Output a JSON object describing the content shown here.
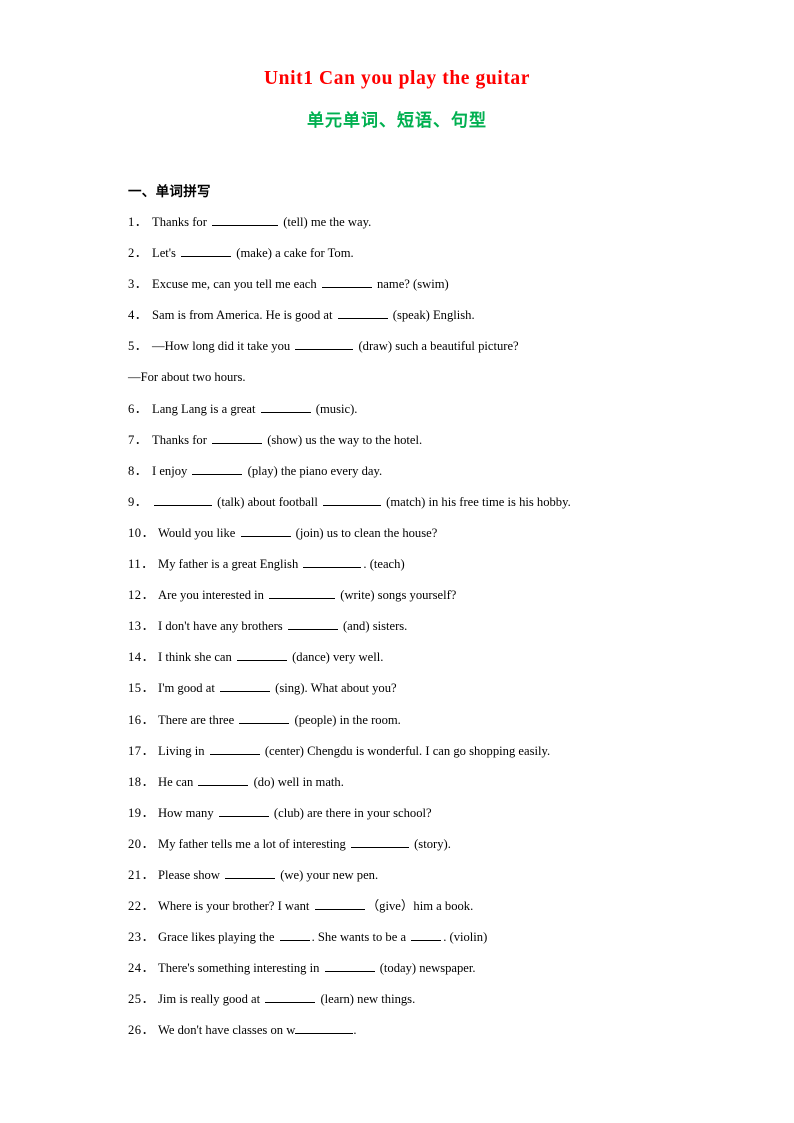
{
  "document": {
    "title": "Unit1 Can you play the guitar",
    "subtitle": "单元单词、短语、句型",
    "title_color": "#FF0000",
    "subtitle_color": "#00B050"
  },
  "section": {
    "heading": "一、单词拼写"
  },
  "questions": [
    {
      "num": "1．",
      "parts": [
        {
          "t": "text",
          "v": "Thanks for "
        },
        {
          "t": "blank",
          "w": "b-xl"
        },
        {
          "t": "text",
          "v": " (tell) me the way."
        }
      ]
    },
    {
      "num": "2．",
      "parts": [
        {
          "t": "text",
          "v": "Let's "
        },
        {
          "t": "blank",
          "w": "b-md"
        },
        {
          "t": "text",
          "v": " (make) a cake for Tom."
        }
      ]
    },
    {
      "num": "3．",
      "parts": [
        {
          "t": "text",
          "v": "Excuse me, can you tell me each "
        },
        {
          "t": "blank",
          "w": "b-md"
        },
        {
          "t": "text",
          "v": " name? (swim)"
        }
      ]
    },
    {
      "num": "4．",
      "parts": [
        {
          "t": "text",
          "v": "Sam is from America. He is good at "
        },
        {
          "t": "blank",
          "w": "b-md"
        },
        {
          "t": "text",
          "v": " (speak) English."
        }
      ]
    },
    {
      "num": "5．",
      "parts": [
        {
          "t": "text",
          "v": "—How long did it take you "
        },
        {
          "t": "blank",
          "w": "b-lg"
        },
        {
          "t": "text",
          "v": " (draw) such a beautiful picture?"
        }
      ]
    },
    {
      "num": "",
      "continuation": true,
      "parts": [
        {
          "t": "text",
          "v": "—For about two hours."
        }
      ]
    },
    {
      "num": "6．",
      "parts": [
        {
          "t": "text",
          "v": "Lang Lang is a great "
        },
        {
          "t": "blank",
          "w": "b-md"
        },
        {
          "t": "text",
          "v": " (music)."
        }
      ]
    },
    {
      "num": "7．",
      "parts": [
        {
          "t": "text",
          "v": "Thanks for "
        },
        {
          "t": "blank",
          "w": "b-md"
        },
        {
          "t": "text",
          "v": " (show) us the way to the hotel."
        }
      ]
    },
    {
      "num": "8．",
      "parts": [
        {
          "t": "text",
          "v": "I enjoy "
        },
        {
          "t": "blank",
          "w": "b-md"
        },
        {
          "t": "text",
          "v": " (play) the piano every day."
        }
      ]
    },
    {
      "num": "9．",
      "parts": [
        {
          "t": "blank",
          "w": "b-lg"
        },
        {
          "t": "text",
          "v": " (talk) about football "
        },
        {
          "t": "blank",
          "w": "b-lg"
        },
        {
          "t": "text",
          "v": " (match) in his free time is his hobby."
        }
      ]
    },
    {
      "num": "10．",
      "wide": true,
      "parts": [
        {
          "t": "text",
          "v": "Would you like "
        },
        {
          "t": "blank",
          "w": "b-md"
        },
        {
          "t": "text",
          "v": " (join) us to clean the house?"
        }
      ]
    },
    {
      "num": "11．",
      "wide": true,
      "parts": [
        {
          "t": "text",
          "v": "My father is a great English "
        },
        {
          "t": "blank",
          "w": "b-lg"
        },
        {
          "t": "text",
          "v": ". (teach)"
        }
      ]
    },
    {
      "num": "12．",
      "wide": true,
      "parts": [
        {
          "t": "text",
          "v": "Are you interested in "
        },
        {
          "t": "blank",
          "w": "b-xl"
        },
        {
          "t": "text",
          "v": " (write) songs yourself?"
        }
      ]
    },
    {
      "num": "13．",
      "wide": true,
      "parts": [
        {
          "t": "text",
          "v": "I don't have any brothers "
        },
        {
          "t": "blank",
          "w": "b-md"
        },
        {
          "t": "text",
          "v": " (and) sisters."
        }
      ]
    },
    {
      "num": "14．",
      "wide": true,
      "parts": [
        {
          "t": "text",
          "v": "I think she can "
        },
        {
          "t": "blank",
          "w": "b-md"
        },
        {
          "t": "text",
          "v": " (dance) very well."
        }
      ]
    },
    {
      "num": "15．",
      "wide": true,
      "parts": [
        {
          "t": "text",
          "v": "I'm good at "
        },
        {
          "t": "blank",
          "w": "b-md"
        },
        {
          "t": "text",
          "v": " (sing). What about you?"
        }
      ]
    },
    {
      "num": "16．",
      "wide": true,
      "parts": [
        {
          "t": "text",
          "v": "There are three "
        },
        {
          "t": "blank",
          "w": "b-md"
        },
        {
          "t": "text",
          "v": " (people) in the room."
        }
      ]
    },
    {
      "num": "17．",
      "wide": true,
      "parts": [
        {
          "t": "text",
          "v": "Living in "
        },
        {
          "t": "blank",
          "w": "b-md"
        },
        {
          "t": "text",
          "v": " (center) Chengdu is wonderful. I can go shopping easily."
        }
      ]
    },
    {
      "num": "18．",
      "wide": true,
      "parts": [
        {
          "t": "text",
          "v": "He can "
        },
        {
          "t": "blank",
          "w": "b-md"
        },
        {
          "t": "text",
          "v": " (do) well in math."
        }
      ]
    },
    {
      "num": "19．",
      "wide": true,
      "parts": [
        {
          "t": "text",
          "v": "How many "
        },
        {
          "t": "blank",
          "w": "b-md"
        },
        {
          "t": "text",
          "v": " (club) are there in your school?"
        }
      ]
    },
    {
      "num": "20．",
      "wide": true,
      "parts": [
        {
          "t": "text",
          "v": "My father tells me a lot of interesting "
        },
        {
          "t": "blank",
          "w": "b-lg"
        },
        {
          "t": "text",
          "v": " (story)."
        }
      ]
    },
    {
      "num": "21．",
      "wide": true,
      "parts": [
        {
          "t": "text",
          "v": "Please show "
        },
        {
          "t": "blank",
          "w": "b-md"
        },
        {
          "t": "text",
          "v": " (we) your new pen."
        }
      ]
    },
    {
      "num": "22．",
      "wide": true,
      "parts": [
        {
          "t": "text",
          "v": "Where is your brother? I want "
        },
        {
          "t": "blank",
          "w": "b-md"
        },
        {
          "t": "text",
          "v": "（give）him a book."
        }
      ]
    },
    {
      "num": "23．",
      "wide": true,
      "parts": [
        {
          "t": "text",
          "v": "Grace likes playing the "
        },
        {
          "t": "blank",
          "w": "b-xs"
        },
        {
          "t": "text",
          "v": ". She wants to be a "
        },
        {
          "t": "blank",
          "w": "b-xs"
        },
        {
          "t": "text",
          "v": ". (violin)"
        }
      ]
    },
    {
      "num": "24．",
      "wide": true,
      "parts": [
        {
          "t": "text",
          "v": "There's something interesting in "
        },
        {
          "t": "blank",
          "w": "b-md"
        },
        {
          "t": "text",
          "v": " (today) newspaper."
        }
      ]
    },
    {
      "num": "25．",
      "wide": true,
      "parts": [
        {
          "t": "text",
          "v": "Jim is really good at "
        },
        {
          "t": "blank",
          "w": "b-md"
        },
        {
          "t": "text",
          "v": " (learn) new things."
        }
      ]
    },
    {
      "num": "26．",
      "wide": true,
      "parts": [
        {
          "t": "text",
          "v": "We don't have classes on w"
        },
        {
          "t": "blank",
          "w": "b-lg",
          "tight": true
        },
        {
          "t": "text",
          "v": "."
        }
      ]
    }
  ]
}
